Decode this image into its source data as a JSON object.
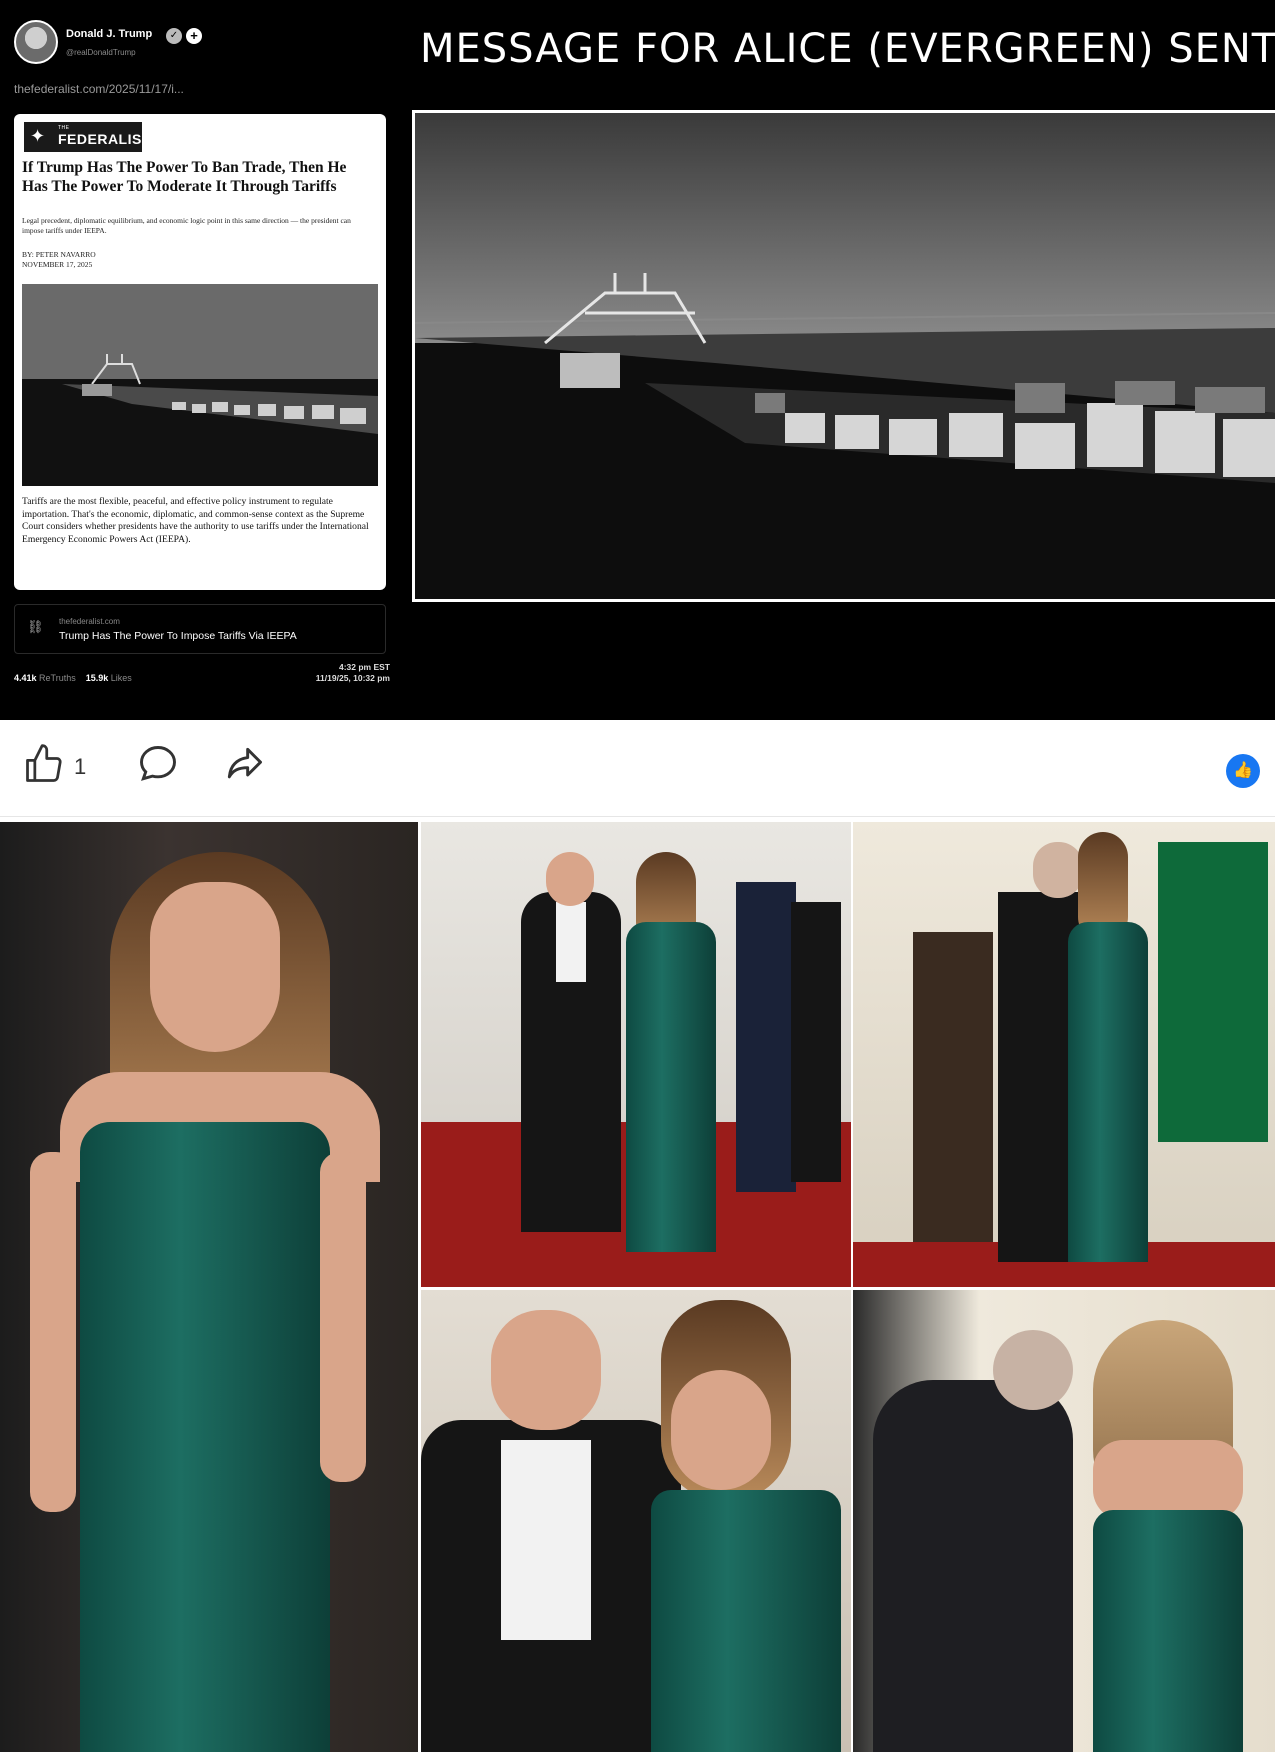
{
  "post_image": {
    "author": {
      "name": "Donald J. Trump",
      "handle": "@realDonaldTrump",
      "verified_icon": "check-badge-icon",
      "follow_icon": "plus-icon"
    },
    "link_url": "thefederalist.com/2025/11/17/i...",
    "article": {
      "publication_small": "THE",
      "publication": "FEDERALIST",
      "title": "If Trump Has The Power To Ban Trade, Then He Has The Power To Moderate It Through Tariffs",
      "subtitle": "Legal precedent, diplomatic equilibrium, and economic logic point in this same direction — the president can impose tariffs under IEEPA.",
      "byline": "BY: PETER NAVARRO",
      "date": "NOVEMBER 17, 2025",
      "body": "Tariffs are the most flexible, peaceful, and effective policy instrument to regulate importation. That's the economic, diplomatic, and common-sense context as the Supreme Court considers whether presidents have the authority to use tariffs under the International Emergency Economic Powers Act (IEEPA)."
    },
    "link_preview": {
      "domain": "thefederalist.com",
      "title": "Trump Has The Power To Impose Tariffs Via IEEPA"
    },
    "stats": {
      "retruths_count": "4.41k",
      "retruths_label": "ReTruths",
      "likes_count": "15.9k",
      "likes_label": "Likes"
    },
    "timestamp": {
      "time": "4:32 pm EST",
      "date": "11/19/25, 10:32 pm"
    },
    "overlay_message": "MESSAGE FOR ALICE (EVERGREEN) SENT"
  },
  "actions": {
    "like_count": "1",
    "reaction_badge_icon": "thumbs-up-icon",
    "accent": "#1877f2"
  },
  "colors": {
    "gown_green": "#1d6e62",
    "carpet_red": "#9a1c1a"
  }
}
